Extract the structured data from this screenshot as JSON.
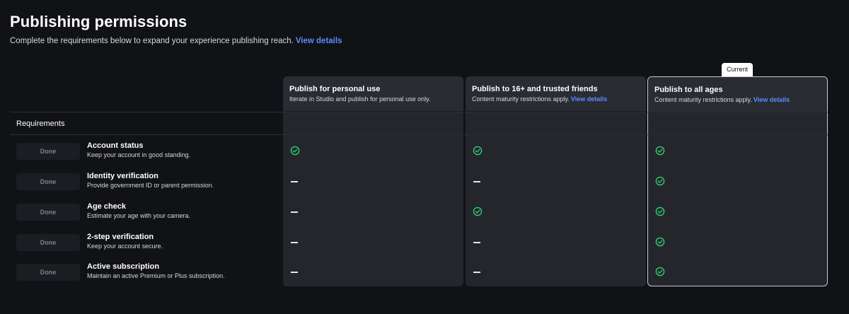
{
  "header": {
    "title": "Publishing permissions",
    "subtitle": "Complete the requirements below to expand your experience publishing reach.",
    "view_details": "View details"
  },
  "current_badge": "Current",
  "tiers": [
    {
      "title": "Publish for personal use",
      "desc": "Iterate in Studio and publish for personal use only.",
      "link": ""
    },
    {
      "title": "Publish to 16+ and trusted friends",
      "desc": "Content maturity restrictions apply.",
      "link": "View details"
    },
    {
      "title": "Publish to all ages",
      "desc": "Content maturity restrictions apply.",
      "link": "View details",
      "current": true
    }
  ],
  "requirements_label": "Requirements",
  "requirements": [
    {
      "status": "Done",
      "name": "Account status",
      "desc": "Keep your account in good standing.",
      "met": [
        "check",
        "check",
        "check"
      ]
    },
    {
      "status": "Done",
      "name": "Identity verification",
      "desc": "Provide government ID or parent permission.",
      "met": [
        "dash",
        "dash",
        "check"
      ]
    },
    {
      "status": "Done",
      "name": "Age check",
      "desc": "Estimate your age with your camera.",
      "met": [
        "dash",
        "check",
        "check"
      ]
    },
    {
      "status": "Done",
      "name": "2-step verification",
      "desc": "Keep your account secure.",
      "met": [
        "dash",
        "dash",
        "check"
      ]
    },
    {
      "status": "Done",
      "name": "Active subscription",
      "desc": "Maintain an active Premium or Plus subscription.",
      "met": [
        "dash",
        "dash",
        "check"
      ]
    }
  ],
  "colors": {
    "check": "#2ecc71",
    "link": "#5b8cff",
    "background": "#111216"
  },
  "icons": {
    "check": "check-circle-icon",
    "dash": "dash-icon"
  }
}
